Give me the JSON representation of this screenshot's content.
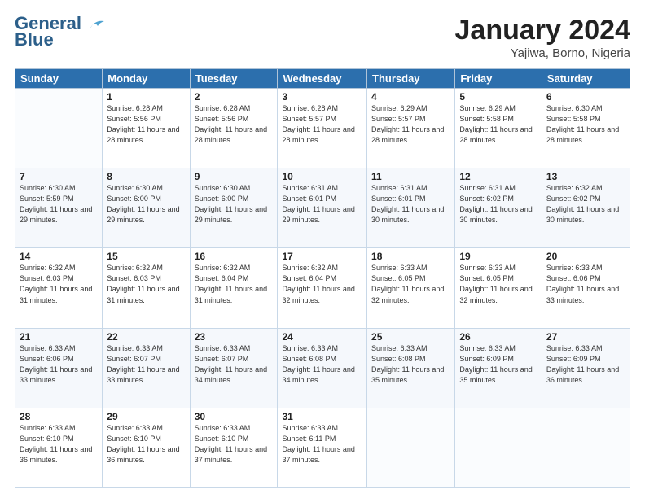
{
  "header": {
    "logo_line1": "General",
    "logo_line2": "Blue",
    "month": "January 2024",
    "location": "Yajiwa, Borno, Nigeria"
  },
  "weekdays": [
    "Sunday",
    "Monday",
    "Tuesday",
    "Wednesday",
    "Thursday",
    "Friday",
    "Saturday"
  ],
  "weeks": [
    [
      {
        "day": "",
        "sunrise": "",
        "sunset": "",
        "daylight": ""
      },
      {
        "day": "1",
        "sunrise": "6:28 AM",
        "sunset": "5:56 PM",
        "daylight": "11 hours and 28 minutes."
      },
      {
        "day": "2",
        "sunrise": "6:28 AM",
        "sunset": "5:56 PM",
        "daylight": "11 hours and 28 minutes."
      },
      {
        "day": "3",
        "sunrise": "6:28 AM",
        "sunset": "5:57 PM",
        "daylight": "11 hours and 28 minutes."
      },
      {
        "day": "4",
        "sunrise": "6:29 AM",
        "sunset": "5:57 PM",
        "daylight": "11 hours and 28 minutes."
      },
      {
        "day": "5",
        "sunrise": "6:29 AM",
        "sunset": "5:58 PM",
        "daylight": "11 hours and 28 minutes."
      },
      {
        "day": "6",
        "sunrise": "6:30 AM",
        "sunset": "5:58 PM",
        "daylight": "11 hours and 28 minutes."
      }
    ],
    [
      {
        "day": "7",
        "sunrise": "6:30 AM",
        "sunset": "5:59 PM",
        "daylight": "11 hours and 29 minutes."
      },
      {
        "day": "8",
        "sunrise": "6:30 AM",
        "sunset": "6:00 PM",
        "daylight": "11 hours and 29 minutes."
      },
      {
        "day": "9",
        "sunrise": "6:30 AM",
        "sunset": "6:00 PM",
        "daylight": "11 hours and 29 minutes."
      },
      {
        "day": "10",
        "sunrise": "6:31 AM",
        "sunset": "6:01 PM",
        "daylight": "11 hours and 29 minutes."
      },
      {
        "day": "11",
        "sunrise": "6:31 AM",
        "sunset": "6:01 PM",
        "daylight": "11 hours and 30 minutes."
      },
      {
        "day": "12",
        "sunrise": "6:31 AM",
        "sunset": "6:02 PM",
        "daylight": "11 hours and 30 minutes."
      },
      {
        "day": "13",
        "sunrise": "6:32 AM",
        "sunset": "6:02 PM",
        "daylight": "11 hours and 30 minutes."
      }
    ],
    [
      {
        "day": "14",
        "sunrise": "6:32 AM",
        "sunset": "6:03 PM",
        "daylight": "11 hours and 31 minutes."
      },
      {
        "day": "15",
        "sunrise": "6:32 AM",
        "sunset": "6:03 PM",
        "daylight": "11 hours and 31 minutes."
      },
      {
        "day": "16",
        "sunrise": "6:32 AM",
        "sunset": "6:04 PM",
        "daylight": "11 hours and 31 minutes."
      },
      {
        "day": "17",
        "sunrise": "6:32 AM",
        "sunset": "6:04 PM",
        "daylight": "11 hours and 32 minutes."
      },
      {
        "day": "18",
        "sunrise": "6:33 AM",
        "sunset": "6:05 PM",
        "daylight": "11 hours and 32 minutes."
      },
      {
        "day": "19",
        "sunrise": "6:33 AM",
        "sunset": "6:05 PM",
        "daylight": "11 hours and 32 minutes."
      },
      {
        "day": "20",
        "sunrise": "6:33 AM",
        "sunset": "6:06 PM",
        "daylight": "11 hours and 33 minutes."
      }
    ],
    [
      {
        "day": "21",
        "sunrise": "6:33 AM",
        "sunset": "6:06 PM",
        "daylight": "11 hours and 33 minutes."
      },
      {
        "day": "22",
        "sunrise": "6:33 AM",
        "sunset": "6:07 PM",
        "daylight": "11 hours and 33 minutes."
      },
      {
        "day": "23",
        "sunrise": "6:33 AM",
        "sunset": "6:07 PM",
        "daylight": "11 hours and 34 minutes."
      },
      {
        "day": "24",
        "sunrise": "6:33 AM",
        "sunset": "6:08 PM",
        "daylight": "11 hours and 34 minutes."
      },
      {
        "day": "25",
        "sunrise": "6:33 AM",
        "sunset": "6:08 PM",
        "daylight": "11 hours and 35 minutes."
      },
      {
        "day": "26",
        "sunrise": "6:33 AM",
        "sunset": "6:09 PM",
        "daylight": "11 hours and 35 minutes."
      },
      {
        "day": "27",
        "sunrise": "6:33 AM",
        "sunset": "6:09 PM",
        "daylight": "11 hours and 36 minutes."
      }
    ],
    [
      {
        "day": "28",
        "sunrise": "6:33 AM",
        "sunset": "6:10 PM",
        "daylight": "11 hours and 36 minutes."
      },
      {
        "day": "29",
        "sunrise": "6:33 AM",
        "sunset": "6:10 PM",
        "daylight": "11 hours and 36 minutes."
      },
      {
        "day": "30",
        "sunrise": "6:33 AM",
        "sunset": "6:10 PM",
        "daylight": "11 hours and 37 minutes."
      },
      {
        "day": "31",
        "sunrise": "6:33 AM",
        "sunset": "6:11 PM",
        "daylight": "11 hours and 37 minutes."
      },
      {
        "day": "",
        "sunrise": "",
        "sunset": "",
        "daylight": ""
      },
      {
        "day": "",
        "sunrise": "",
        "sunset": "",
        "daylight": ""
      },
      {
        "day": "",
        "sunrise": "",
        "sunset": "",
        "daylight": ""
      }
    ]
  ]
}
